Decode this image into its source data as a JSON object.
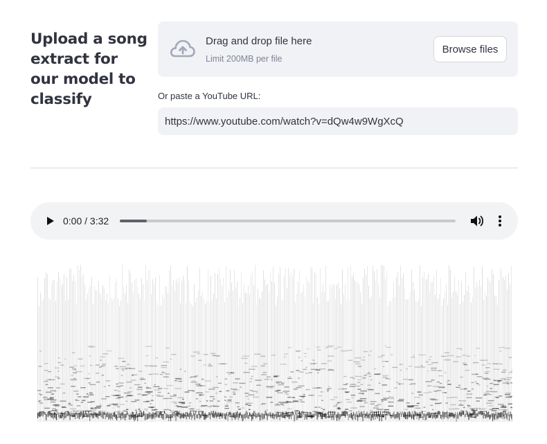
{
  "page": {
    "title": "Upload a song extract for our model to classify"
  },
  "uploader": {
    "icon": "cloud-upload-icon",
    "drag_text": "Drag and drop file here",
    "limit_text": "Limit 200MB per file",
    "browse_label": "Browse files"
  },
  "youtube": {
    "label": "Or paste a YouTube URL:",
    "value": "https://www.youtube.com/watch?v=dQw4w9WgXcQ"
  },
  "player": {
    "time": "0:00 / 3:32",
    "progress_fraction": 0.08,
    "play_icon": "play-icon",
    "volume_icon": "volume-icon",
    "more_icon": "more-vert-icon"
  },
  "colors": {
    "panel_bg": "#f0f2f6",
    "text": "#31333f",
    "muted": "#808495",
    "icon": "#a3a8b8"
  }
}
